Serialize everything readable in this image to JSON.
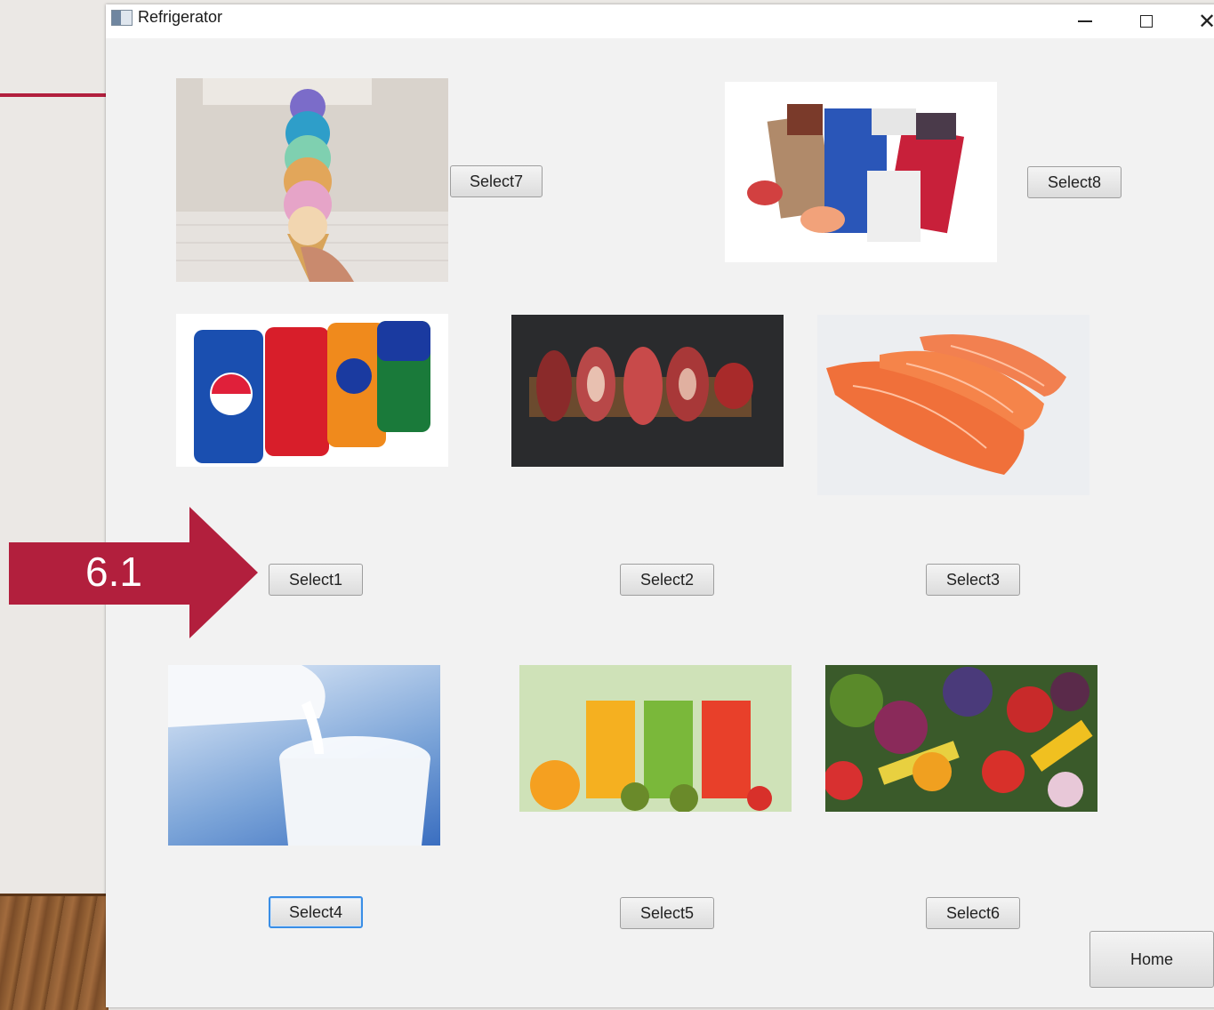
{
  "window": {
    "title": "Refrigerator",
    "controls": {
      "minimize": "minimize-icon",
      "maximize": "maximize-icon",
      "close": "close-icon"
    }
  },
  "annotation": {
    "label": "6.1",
    "color": "#b21f3d"
  },
  "items": [
    {
      "id": "ice-cream",
      "button": "Select7"
    },
    {
      "id": "frozen-seafood",
      "button": "Select8"
    },
    {
      "id": "soda-cans",
      "button": "Select1"
    },
    {
      "id": "meat",
      "button": "Select2"
    },
    {
      "id": "salmon",
      "button": "Select3"
    },
    {
      "id": "milk",
      "button": "Select4"
    },
    {
      "id": "juice",
      "button": "Select5"
    },
    {
      "id": "vegetables",
      "button": "Select6"
    }
  ],
  "home_button": "Home"
}
